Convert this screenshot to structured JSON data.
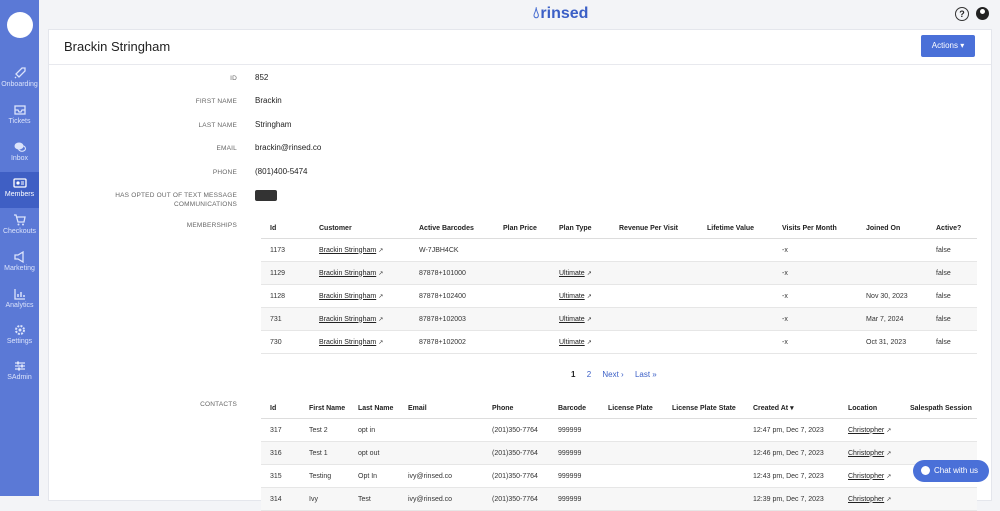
{
  "app": {
    "brand": "rinsed"
  },
  "sidebar": {
    "logo_text": "",
    "items": [
      {
        "label": "Onboarding",
        "icon": "rocket-icon"
      },
      {
        "label": "Tickets",
        "icon": "inbox-icon"
      },
      {
        "label": "Inbox",
        "icon": "chat-icon"
      },
      {
        "label": "Members",
        "icon": "members-icon",
        "active": true
      },
      {
        "label": "Checkouts",
        "icon": "cart-icon"
      },
      {
        "label": "Marketing",
        "icon": "megaphone-icon"
      },
      {
        "label": "Analytics",
        "icon": "chart-icon"
      },
      {
        "label": "Settings",
        "icon": "gear-icon"
      },
      {
        "label": "SAdmin",
        "icon": "sliders-icon"
      }
    ]
  },
  "header": {
    "title": "Brackin Stringham",
    "actions_label": "Actions"
  },
  "fields": {
    "id_label": "ID",
    "id": "852",
    "first_name_label": "FIRST NAME",
    "first_name": "Brackin",
    "last_name_label": "LAST NAME",
    "last_name": "Stringham",
    "email_label": "EMAIL",
    "email": "brackin@rinsed.co",
    "phone_label": "PHONE",
    "phone": "(801)400-5474",
    "opt_out_label_1": "HAS OPTED OUT OF TEXT MESSAGE",
    "opt_out_label_2": "COMMUNICATIONS"
  },
  "memberships": {
    "label": "MEMBERSHIPS",
    "headers": [
      "Id",
      "Customer",
      "Active Barcodes",
      "Plan Price",
      "Plan Type",
      "Revenue Per Visit",
      "Lifetime Value",
      "Visits Per Month",
      "Joined On",
      "Active?"
    ],
    "rows": [
      [
        "1173",
        "Brackin Stringham",
        "W-7JBH4CK",
        "",
        "",
        "",
        "",
        "-x",
        "",
        "false"
      ],
      [
        "1129",
        "Brackin Stringham",
        "87878+101000",
        "",
        "Ultimate",
        "",
        "",
        "-x",
        "",
        "false"
      ],
      [
        "1128",
        "Brackin Stringham",
        "87878+102400",
        "",
        "Ultimate",
        "",
        "",
        "-x",
        "Nov 30, 2023",
        "false"
      ],
      [
        "731",
        "Brackin Stringham",
        "87878+102003",
        "",
        "Ultimate",
        "",
        "",
        "-x",
        "Mar 7, 2024",
        "false"
      ],
      [
        "730",
        "Brackin Stringham",
        "87878+102002",
        "",
        "Ultimate",
        "",
        "",
        "-x",
        "Oct 31, 2023",
        "false"
      ]
    ],
    "pager": {
      "p1": "1",
      "p2": "2",
      "next": "Next ›",
      "last": "Last »"
    }
  },
  "contacts": {
    "label": "CONTACTS",
    "headers": [
      "Id",
      "First Name",
      "Last Name",
      "Email",
      "Phone",
      "Barcode",
      "License Plate",
      "License Plate State",
      "Created At ▾",
      "Location",
      "Salespath Session"
    ],
    "rows": [
      [
        "317",
        "Test 2",
        "opt in",
        "",
        "(201)350-7764",
        "999999",
        "",
        "",
        "12:47 pm, Dec 7, 2023",
        "Christopher",
        ""
      ],
      [
        "316",
        "Test 1",
        "opt out",
        "",
        "(201)350-7764",
        "999999",
        "",
        "",
        "12:46 pm, Dec 7, 2023",
        "Christopher",
        ""
      ],
      [
        "315",
        "Testing",
        "Opt In",
        "ivy@rinsed.co",
        "(201)350-7764",
        "999999",
        "",
        "",
        "12:43 pm, Dec 7, 2023",
        "Christopher",
        ""
      ],
      [
        "314",
        "Ivy",
        "Test",
        "ivy@rinsed.co",
        "(201)350-7764",
        "999999",
        "",
        "",
        "12:39 pm, Dec 7, 2023",
        "Christopher",
        ""
      ]
    ]
  },
  "chat": {
    "label": "Chat with us"
  }
}
